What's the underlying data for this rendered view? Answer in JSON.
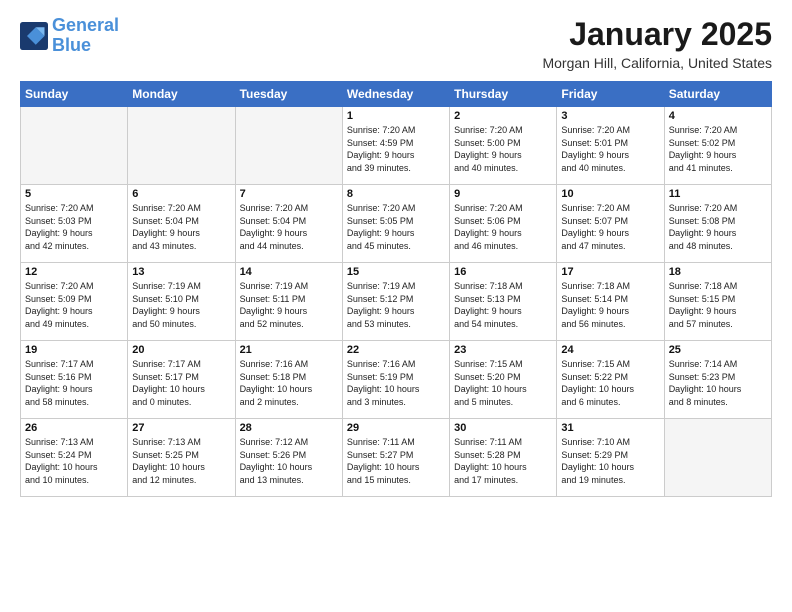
{
  "logo": {
    "line1": "General",
    "line2": "Blue"
  },
  "title": "January 2025",
  "location": "Morgan Hill, California, United States",
  "days_of_week": [
    "Sunday",
    "Monday",
    "Tuesday",
    "Wednesday",
    "Thursday",
    "Friday",
    "Saturday"
  ],
  "weeks": [
    [
      {
        "day": "",
        "content": ""
      },
      {
        "day": "",
        "content": ""
      },
      {
        "day": "",
        "content": ""
      },
      {
        "day": "1",
        "content": "Sunrise: 7:20 AM\nSunset: 4:59 PM\nDaylight: 9 hours\nand 39 minutes."
      },
      {
        "day": "2",
        "content": "Sunrise: 7:20 AM\nSunset: 5:00 PM\nDaylight: 9 hours\nand 40 minutes."
      },
      {
        "day": "3",
        "content": "Sunrise: 7:20 AM\nSunset: 5:01 PM\nDaylight: 9 hours\nand 40 minutes."
      },
      {
        "day": "4",
        "content": "Sunrise: 7:20 AM\nSunset: 5:02 PM\nDaylight: 9 hours\nand 41 minutes."
      }
    ],
    [
      {
        "day": "5",
        "content": "Sunrise: 7:20 AM\nSunset: 5:03 PM\nDaylight: 9 hours\nand 42 minutes."
      },
      {
        "day": "6",
        "content": "Sunrise: 7:20 AM\nSunset: 5:04 PM\nDaylight: 9 hours\nand 43 minutes."
      },
      {
        "day": "7",
        "content": "Sunrise: 7:20 AM\nSunset: 5:04 PM\nDaylight: 9 hours\nand 44 minutes."
      },
      {
        "day": "8",
        "content": "Sunrise: 7:20 AM\nSunset: 5:05 PM\nDaylight: 9 hours\nand 45 minutes."
      },
      {
        "day": "9",
        "content": "Sunrise: 7:20 AM\nSunset: 5:06 PM\nDaylight: 9 hours\nand 46 minutes."
      },
      {
        "day": "10",
        "content": "Sunrise: 7:20 AM\nSunset: 5:07 PM\nDaylight: 9 hours\nand 47 minutes."
      },
      {
        "day": "11",
        "content": "Sunrise: 7:20 AM\nSunset: 5:08 PM\nDaylight: 9 hours\nand 48 minutes."
      }
    ],
    [
      {
        "day": "12",
        "content": "Sunrise: 7:20 AM\nSunset: 5:09 PM\nDaylight: 9 hours\nand 49 minutes."
      },
      {
        "day": "13",
        "content": "Sunrise: 7:19 AM\nSunset: 5:10 PM\nDaylight: 9 hours\nand 50 minutes."
      },
      {
        "day": "14",
        "content": "Sunrise: 7:19 AM\nSunset: 5:11 PM\nDaylight: 9 hours\nand 52 minutes."
      },
      {
        "day": "15",
        "content": "Sunrise: 7:19 AM\nSunset: 5:12 PM\nDaylight: 9 hours\nand 53 minutes."
      },
      {
        "day": "16",
        "content": "Sunrise: 7:18 AM\nSunset: 5:13 PM\nDaylight: 9 hours\nand 54 minutes."
      },
      {
        "day": "17",
        "content": "Sunrise: 7:18 AM\nSunset: 5:14 PM\nDaylight: 9 hours\nand 56 minutes."
      },
      {
        "day": "18",
        "content": "Sunrise: 7:18 AM\nSunset: 5:15 PM\nDaylight: 9 hours\nand 57 minutes."
      }
    ],
    [
      {
        "day": "19",
        "content": "Sunrise: 7:17 AM\nSunset: 5:16 PM\nDaylight: 9 hours\nand 58 minutes."
      },
      {
        "day": "20",
        "content": "Sunrise: 7:17 AM\nSunset: 5:17 PM\nDaylight: 10 hours\nand 0 minutes."
      },
      {
        "day": "21",
        "content": "Sunrise: 7:16 AM\nSunset: 5:18 PM\nDaylight: 10 hours\nand 2 minutes."
      },
      {
        "day": "22",
        "content": "Sunrise: 7:16 AM\nSunset: 5:19 PM\nDaylight: 10 hours\nand 3 minutes."
      },
      {
        "day": "23",
        "content": "Sunrise: 7:15 AM\nSunset: 5:20 PM\nDaylight: 10 hours\nand 5 minutes."
      },
      {
        "day": "24",
        "content": "Sunrise: 7:15 AM\nSunset: 5:22 PM\nDaylight: 10 hours\nand 6 minutes."
      },
      {
        "day": "25",
        "content": "Sunrise: 7:14 AM\nSunset: 5:23 PM\nDaylight: 10 hours\nand 8 minutes."
      }
    ],
    [
      {
        "day": "26",
        "content": "Sunrise: 7:13 AM\nSunset: 5:24 PM\nDaylight: 10 hours\nand 10 minutes."
      },
      {
        "day": "27",
        "content": "Sunrise: 7:13 AM\nSunset: 5:25 PM\nDaylight: 10 hours\nand 12 minutes."
      },
      {
        "day": "28",
        "content": "Sunrise: 7:12 AM\nSunset: 5:26 PM\nDaylight: 10 hours\nand 13 minutes."
      },
      {
        "day": "29",
        "content": "Sunrise: 7:11 AM\nSunset: 5:27 PM\nDaylight: 10 hours\nand 15 minutes."
      },
      {
        "day": "30",
        "content": "Sunrise: 7:11 AM\nSunset: 5:28 PM\nDaylight: 10 hours\nand 17 minutes."
      },
      {
        "day": "31",
        "content": "Sunrise: 7:10 AM\nSunset: 5:29 PM\nDaylight: 10 hours\nand 19 minutes."
      },
      {
        "day": "",
        "content": ""
      }
    ]
  ]
}
